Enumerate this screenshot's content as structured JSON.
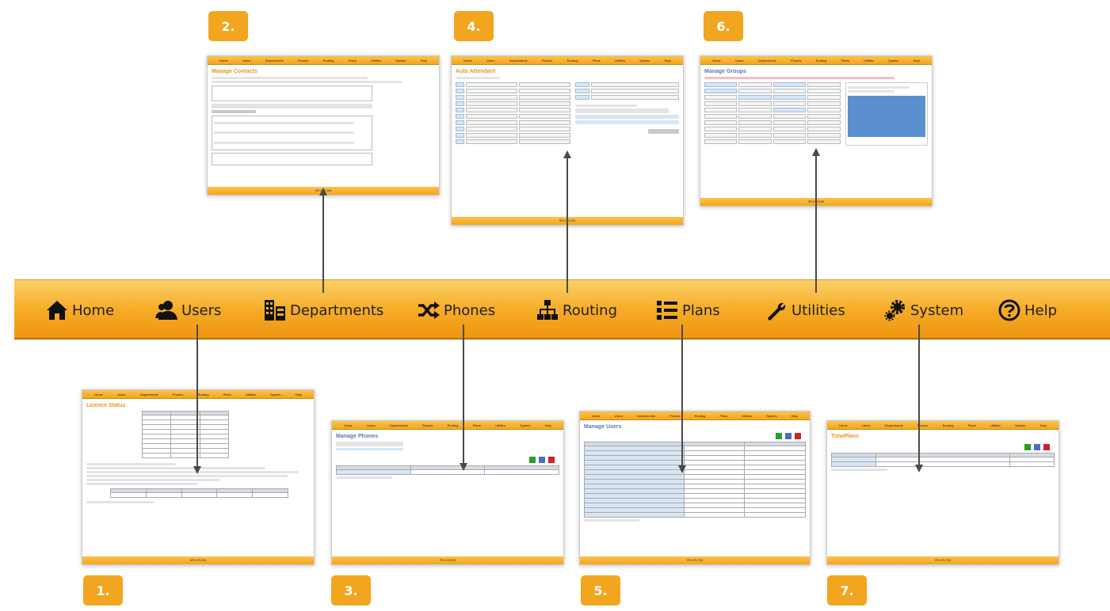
{
  "steps": [
    "1.",
    "2.",
    "3.",
    "4.",
    "5.",
    "6.",
    "7."
  ],
  "nav": [
    {
      "label": "Home",
      "icon": "home-icon"
    },
    {
      "label": "Users",
      "icon": "users-icon"
    },
    {
      "label": "Departments",
      "icon": "departments-icon"
    },
    {
      "label": "Phones",
      "icon": "shuffle-icon"
    },
    {
      "label": "Routing",
      "icon": "sitemap-icon"
    },
    {
      "label": "Plans",
      "icon": "list-icon"
    },
    {
      "label": "Utilities",
      "icon": "wrench-icon"
    },
    {
      "label": "System",
      "icon": "cogs-icon"
    },
    {
      "label": "Help",
      "icon": "help-icon"
    }
  ],
  "mini_nav": [
    "Home",
    "Users",
    "Departments",
    "Phones",
    "Routing",
    "Plans",
    "Utilities",
    "System",
    "Help"
  ],
  "thumbs": {
    "contacts": {
      "title": "Manage Contacts"
    },
    "auto": {
      "title": "Auto Attendant"
    },
    "groups": {
      "title": "Manage Groups"
    },
    "licence": {
      "title": "Licence Status"
    },
    "phones": {
      "title": "Manage Phones"
    },
    "users": {
      "title": "Manage Users"
    },
    "timeplans": {
      "title": "TimePlans"
    }
  },
  "footer_text": "SPLICECOM",
  "colors": {
    "accent": "#f2a51e",
    "bar_top": "#fcd068",
    "bar_bottom": "#ef9510",
    "title": "#e8951c"
  }
}
